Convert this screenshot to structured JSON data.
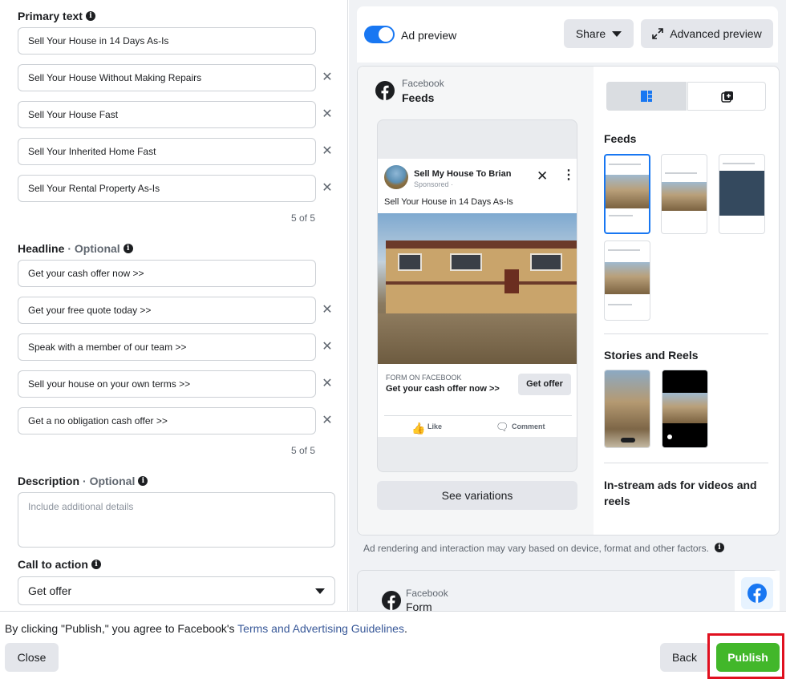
{
  "primary_text": {
    "title": "Primary text",
    "fields": [
      "Sell Your House in 14 Days As-Is",
      "Sell Your House Without Making Repairs",
      "Sell Your House Fast",
      "Sell Your Inherited Home Fast",
      "Sell Your Rental Property As-Is"
    ],
    "counter": "5 of 5"
  },
  "headline": {
    "title": "Headline",
    "optional": "· Optional",
    "fields": [
      "Get your cash offer now >>",
      "Get your free quote today >>",
      "Speak with a member of our team >>",
      "Sell your house on your own terms >>",
      "Get a no obligation cash offer >>"
    ],
    "counter": "5 of 5"
  },
  "description": {
    "title": "Description",
    "optional": "· Optional",
    "placeholder": "Include additional details"
  },
  "call_to_action": {
    "title": "Call to action",
    "selected": "Get offer"
  },
  "preview": {
    "toggle_label": "Ad preview",
    "toggle_on": true,
    "share_label": "Share",
    "advanced_label": "Advanced preview",
    "placement_platform": "Facebook",
    "placement_name": "Feeds",
    "ad": {
      "page_name": "Sell My House To Brian",
      "sponsored": "Sponsored · ",
      "primary_text": "Sell Your House in 14 Days As-Is",
      "cta_caption": "FORM ON FACEBOOK",
      "headline": "Get your cash offer now >>",
      "cta_button": "Get offer",
      "like": "Like",
      "comment": "Comment"
    },
    "see_variations": "See variations",
    "feeds_heading": "Feeds",
    "stories_heading": "Stories and Reels",
    "instream_heading": "In-stream ads for videos and reels",
    "note": "Ad rendering and interaction may vary based on device, format and other factors.",
    "form_platform": "Facebook",
    "form_name": "Form"
  },
  "footer": {
    "agree_prefix": "By clicking \"Publish,\" you agree to Facebook's ",
    "agree_link": "Terms and Advertising Guidelines",
    "agree_suffix": ".",
    "close": "Close",
    "back": "Back",
    "publish": "Publish"
  },
  "colors": {
    "accent": "#1877f2",
    "publish": "#42b72a",
    "highlight": "#e0101f"
  }
}
